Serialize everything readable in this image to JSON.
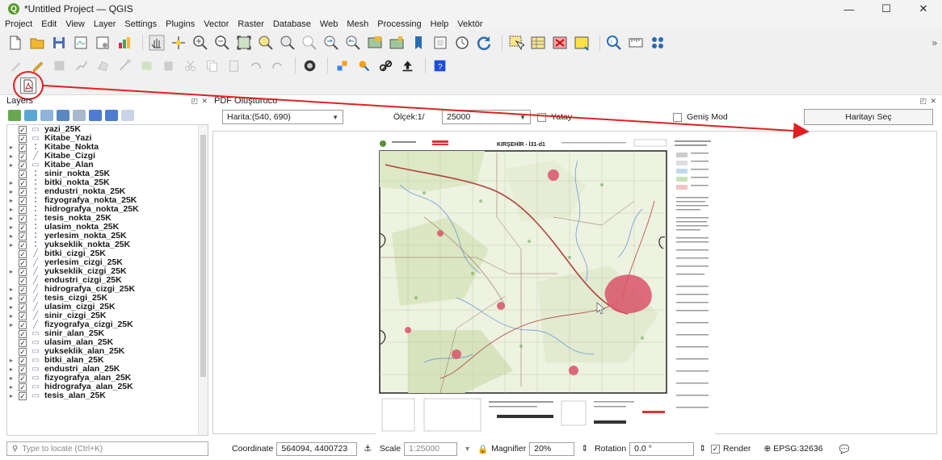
{
  "window": {
    "title": "*Untitled Project — QGIS",
    "minimize": "—",
    "maximize": "☐",
    "close": "✕"
  },
  "menu": [
    "Project",
    "Edit",
    "View",
    "Layer",
    "Settings",
    "Plugins",
    "Vector",
    "Raster",
    "Database",
    "Web",
    "Mesh",
    "Processing",
    "Help",
    "Vektör"
  ],
  "layers_panel": {
    "title": "Layers",
    "search_placeholder": "Type to locate (Ctrl+K)",
    "items": [
      {
        "name": "yazi_25K",
        "checked": true,
        "expandable": false,
        "icon": "polygon-icon"
      },
      {
        "name": "Kitabe_Yazi",
        "checked": true,
        "expandable": false,
        "icon": "polygon-icon"
      },
      {
        "name": "Kitabe_Nokta",
        "checked": true,
        "expandable": true,
        "icon": "point-icon"
      },
      {
        "name": "Kitabe_Cizgi",
        "checked": true,
        "expandable": true,
        "icon": "line-icon"
      },
      {
        "name": "Kitabe_Alan",
        "checked": true,
        "expandable": true,
        "icon": "polygon-icon"
      },
      {
        "name": "sinir_nokta_25K",
        "checked": true,
        "expandable": false,
        "icon": "point-icon"
      },
      {
        "name": "bitki_nokta_25K",
        "checked": true,
        "expandable": true,
        "icon": "point-icon"
      },
      {
        "name": "endustri_nokta_25K",
        "checked": true,
        "expandable": true,
        "icon": "point-icon"
      },
      {
        "name": "fizyografya_nokta_25K",
        "checked": true,
        "expandable": true,
        "icon": "point-icon"
      },
      {
        "name": "hidrografya_nokta_25K",
        "checked": true,
        "expandable": true,
        "icon": "point-icon"
      },
      {
        "name": "tesis_nokta_25K",
        "checked": true,
        "expandable": true,
        "icon": "point-icon"
      },
      {
        "name": "ulasim_nokta_25K",
        "checked": true,
        "expandable": true,
        "icon": "point-icon"
      },
      {
        "name": "yerlesim_nokta_25K",
        "checked": true,
        "expandable": true,
        "icon": "point-icon"
      },
      {
        "name": "yukseklik_nokta_25K",
        "checked": true,
        "expandable": true,
        "icon": "point-icon"
      },
      {
        "name": "bitki_cizgi_25K",
        "checked": true,
        "expandable": false,
        "icon": "line-icon"
      },
      {
        "name": "yerlesim_cizgi_25K",
        "checked": true,
        "expandable": false,
        "icon": "line-icon"
      },
      {
        "name": "yukseklik_cizgi_25K",
        "checked": true,
        "expandable": true,
        "icon": "line-icon"
      },
      {
        "name": "endustri_cizgi_25K",
        "checked": true,
        "expandable": false,
        "icon": "line-icon"
      },
      {
        "name": "hidrografya_cizgi_25K",
        "checked": true,
        "expandable": true,
        "icon": "line-icon"
      },
      {
        "name": "tesis_cizgi_25K",
        "checked": true,
        "expandable": true,
        "icon": "line-icon"
      },
      {
        "name": "ulasim_cizgi_25K",
        "checked": true,
        "expandable": true,
        "icon": "line-icon"
      },
      {
        "name": "sinir_cizgi_25K",
        "checked": true,
        "expandable": true,
        "icon": "line-icon"
      },
      {
        "name": "fizyografya_cizgi_25K",
        "checked": true,
        "expandable": true,
        "icon": "line-icon"
      },
      {
        "name": "sinir_alan_25K",
        "checked": true,
        "expandable": false,
        "icon": "polygon-icon"
      },
      {
        "name": "ulasim_alan_25K",
        "checked": true,
        "expandable": false,
        "icon": "polygon-icon"
      },
      {
        "name": "yukseklik_alan_25K",
        "checked": true,
        "expandable": false,
        "icon": "polygon-icon"
      },
      {
        "name": "bitki_alan_25K",
        "checked": true,
        "expandable": true,
        "icon": "polygon-icon"
      },
      {
        "name": "endustri_alan_25K",
        "checked": true,
        "expandable": true,
        "icon": "polygon-icon"
      },
      {
        "name": "fizyografya_alan_25K",
        "checked": true,
        "expandable": true,
        "icon": "polygon-icon"
      },
      {
        "name": "hidrografya_alan_25K",
        "checked": true,
        "expandable": true,
        "icon": "polygon-icon"
      },
      {
        "name": "tesis_alan_25K",
        "checked": true,
        "expandable": true,
        "icon": "polygon-icon"
      }
    ]
  },
  "pdf_panel": {
    "title": "PDF Oluşturucu",
    "map_combo": "Harita:(540, 690)",
    "scale_label": "Ölçek:1/",
    "scale_value": "25000",
    "landscape_label": "Yatay",
    "wide_mode_label": "Geniş Mod",
    "select_map_button": "Haritayı Seç"
  },
  "map_sheet": {
    "title": "KIRŞEHİR - İ31-d1"
  },
  "statusbar": {
    "coordinate_label": "Coordinate",
    "coordinate_value": "564094, 4400723",
    "scale_label": "Scale",
    "scale_value": "1:25000",
    "magnifier_label": "Magnifier",
    "magnifier_value": "20%",
    "rotation_label": "Rotation",
    "rotation_value": "0.0 °",
    "render_label": "Render",
    "crs": "EPSG:32636"
  },
  "colors": {
    "annotation_red": "#e02020",
    "qgis_green": "#5c9b2f",
    "map_urban": "#d9536a",
    "map_road": "#b0433a"
  }
}
